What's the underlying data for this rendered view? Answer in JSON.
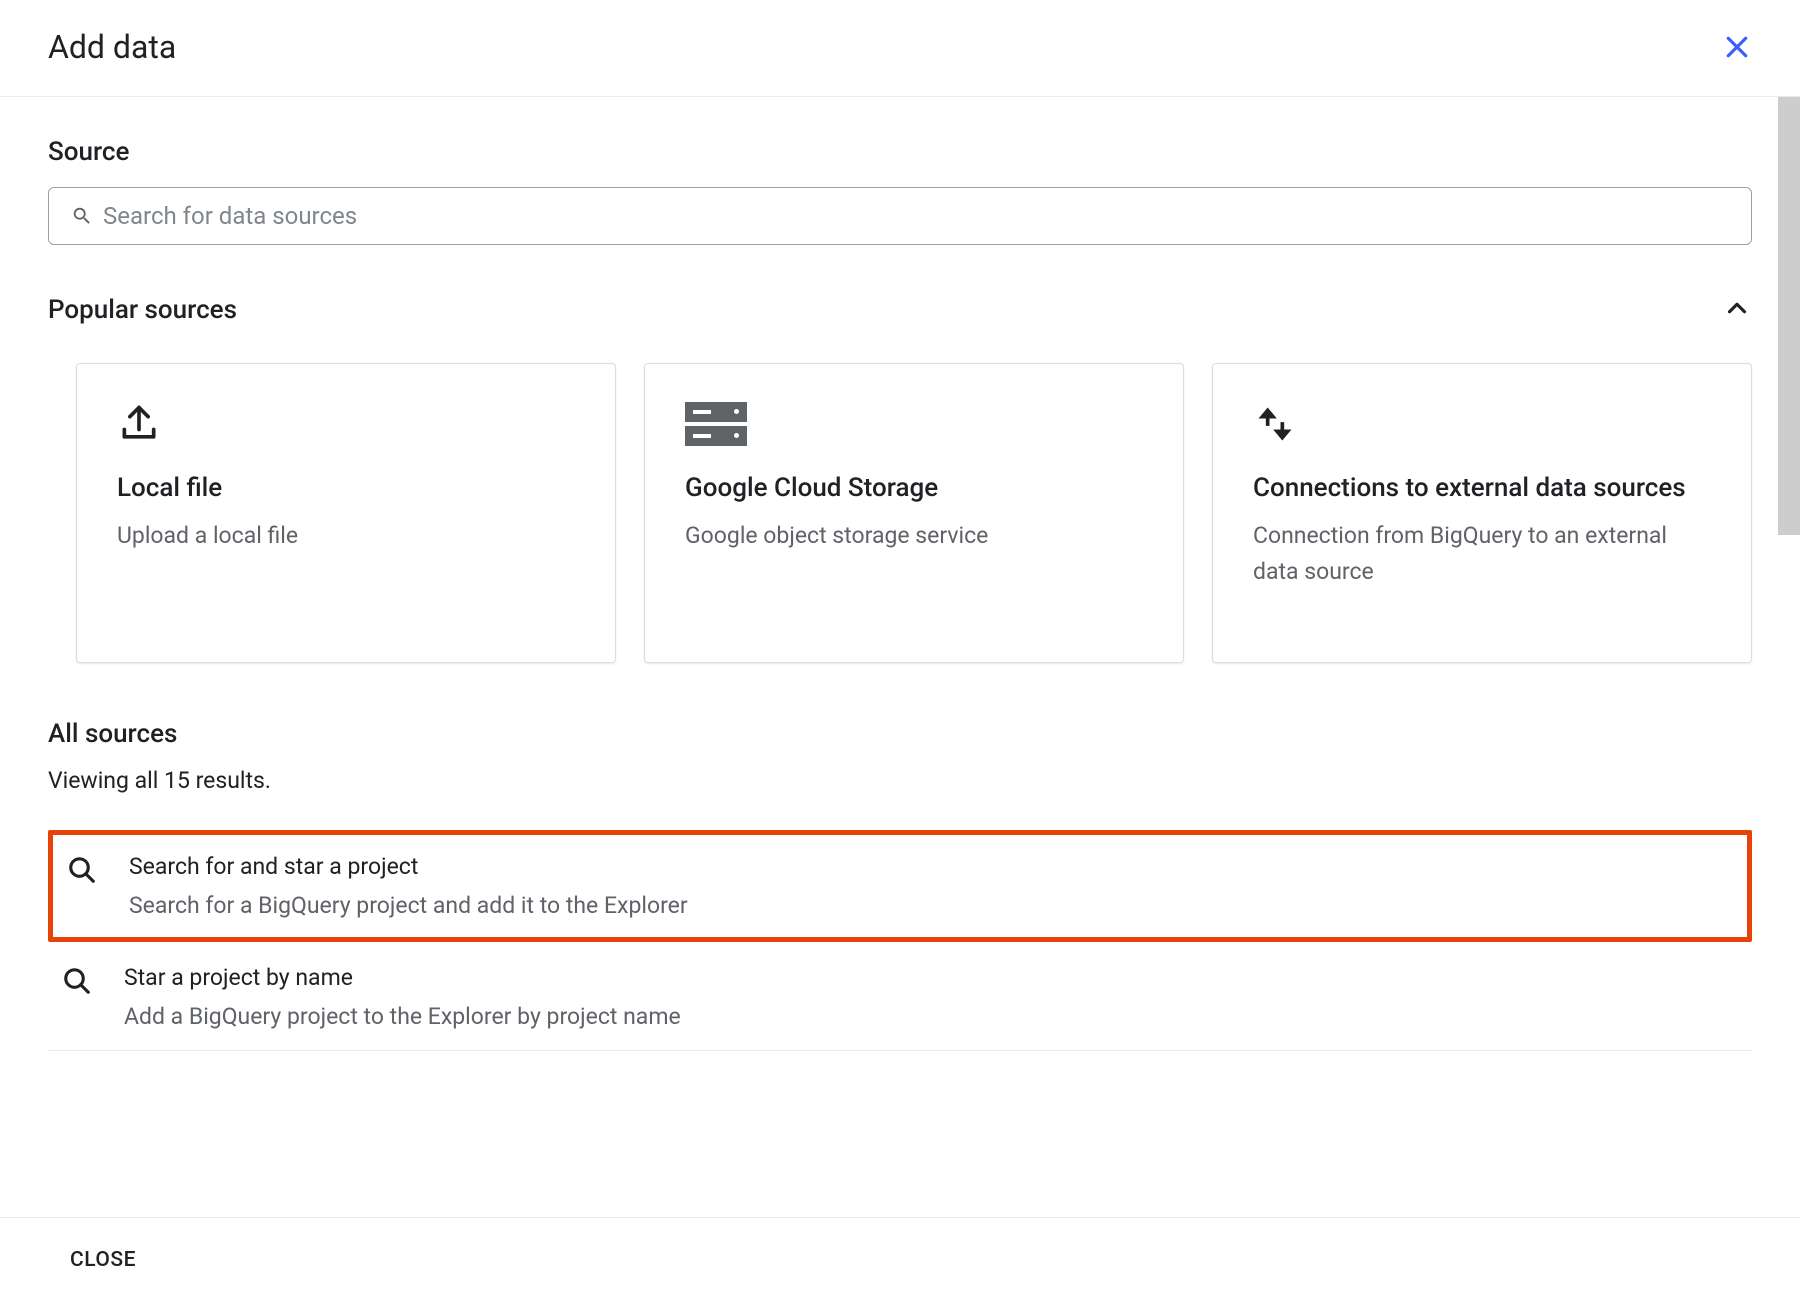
{
  "header": {
    "title": "Add data"
  },
  "source": {
    "label": "Source",
    "search_placeholder": "Search for data sources"
  },
  "popular": {
    "title": "Popular sources",
    "cards": [
      {
        "icon": "upload",
        "title": "Local file",
        "desc": "Upload a local file"
      },
      {
        "icon": "storage",
        "title": "Google Cloud Storage",
        "desc": "Google object storage service"
      },
      {
        "icon": "sync",
        "title": "Connections to external data sources",
        "desc": "Connection from BigQuery to an external data source"
      }
    ]
  },
  "all_sources": {
    "title": "All sources",
    "results_text": "Viewing all 15 results.",
    "rows": [
      {
        "icon": "search",
        "title": "Search for and star a project",
        "desc": "Search for a BigQuery project and add it to the Explorer",
        "highlighted": true
      },
      {
        "icon": "search",
        "title": "Star a project by name",
        "desc": "Add a BigQuery project to the Explorer by project name",
        "highlighted": false
      }
    ]
  },
  "footer": {
    "close_label": "CLOSE"
  }
}
